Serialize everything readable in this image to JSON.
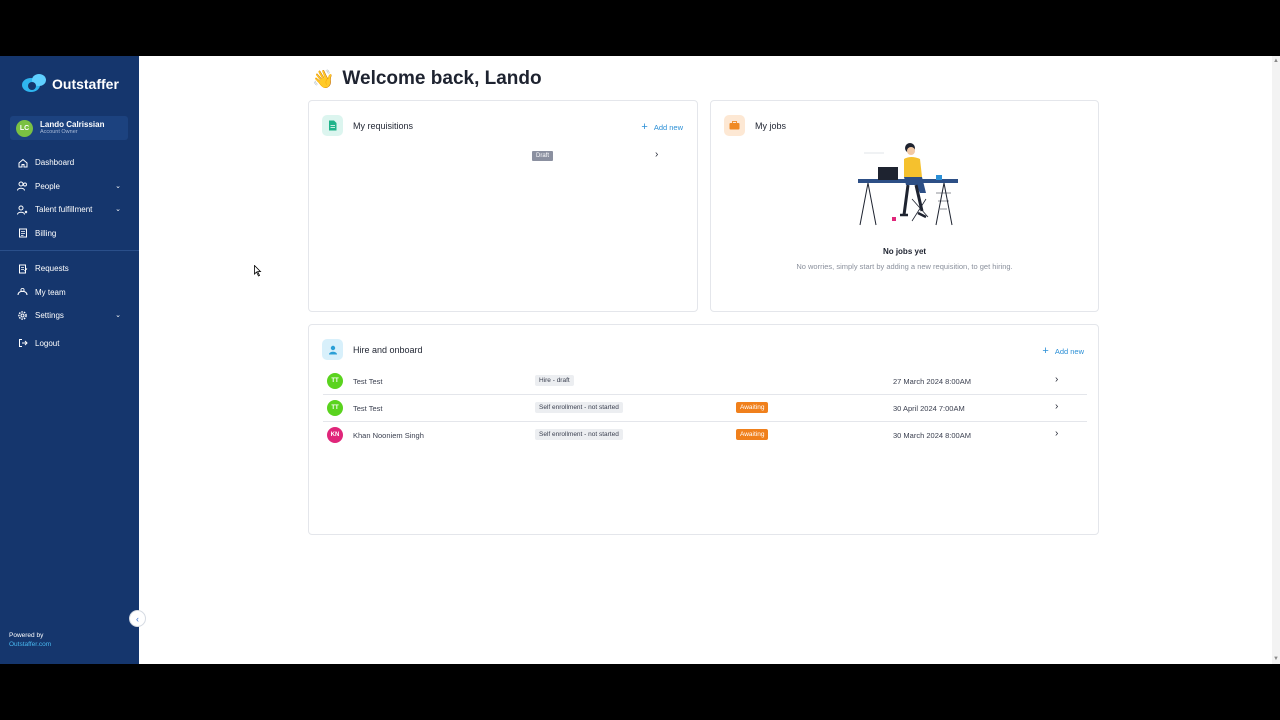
{
  "sidebar": {
    "brand": "Outstaffer",
    "user": {
      "initials": "LC",
      "name": "Lando Calrissian",
      "role": "Account Owner"
    },
    "items": [
      {
        "label": "Dashboard",
        "icon": "home-icon"
      },
      {
        "label": "People",
        "icon": "people-icon",
        "chevron": "⌄"
      },
      {
        "label": "Talent fulfillment",
        "icon": "talent-icon",
        "chevron": "⌄"
      },
      {
        "label": "Billing",
        "icon": "billing-icon"
      },
      {
        "label": "Requests",
        "icon": "requests-icon"
      },
      {
        "label": "My team",
        "icon": "team-icon"
      },
      {
        "label": "Settings",
        "icon": "gear-icon",
        "chevron": "⌄"
      },
      {
        "label": "Logout",
        "icon": "logout-icon"
      }
    ],
    "powered_by": "Powered by",
    "powered_link": "Outstaffer.com",
    "collapse": "‹"
  },
  "header": {
    "wave": "👋",
    "title": "Welcome back, Lando"
  },
  "requisitions": {
    "title": "My requisitions",
    "add_new": "Add new",
    "plus": "+",
    "row": {
      "status": "Draft",
      "chevron": "›"
    }
  },
  "jobs": {
    "title": "My jobs",
    "empty_title": "No jobs yet",
    "empty_sub": "No worries, simply start by adding a new requisition, to get hiring."
  },
  "hire": {
    "title": "Hire and onboard",
    "add_new": "Add new",
    "plus": "+",
    "rows": [
      {
        "initials": "TT",
        "name": "Test Test",
        "status": "Hire - draft",
        "badge": "",
        "date": "27 March 2024 8:00AM",
        "chevron": "›"
      },
      {
        "initials": "TT",
        "name": "Test Test",
        "status": "Self enrollment - not started",
        "badge": "Awaiting",
        "date": "30 April 2024 7:00AM",
        "chevron": "›"
      },
      {
        "initials": "KN",
        "name": "Khan Nooniem Singh",
        "status": "Self enrollment - not started",
        "badge": "Awaiting",
        "date": "30 March 2024 8:00AM",
        "chevron": "›"
      }
    ]
  },
  "colors": {
    "sidebar": "#15366d",
    "accent": "#2b8fd6",
    "awaiting": "#f0801c",
    "avatar_green": "#5ad31e",
    "avatar_pink": "#e0267a"
  }
}
